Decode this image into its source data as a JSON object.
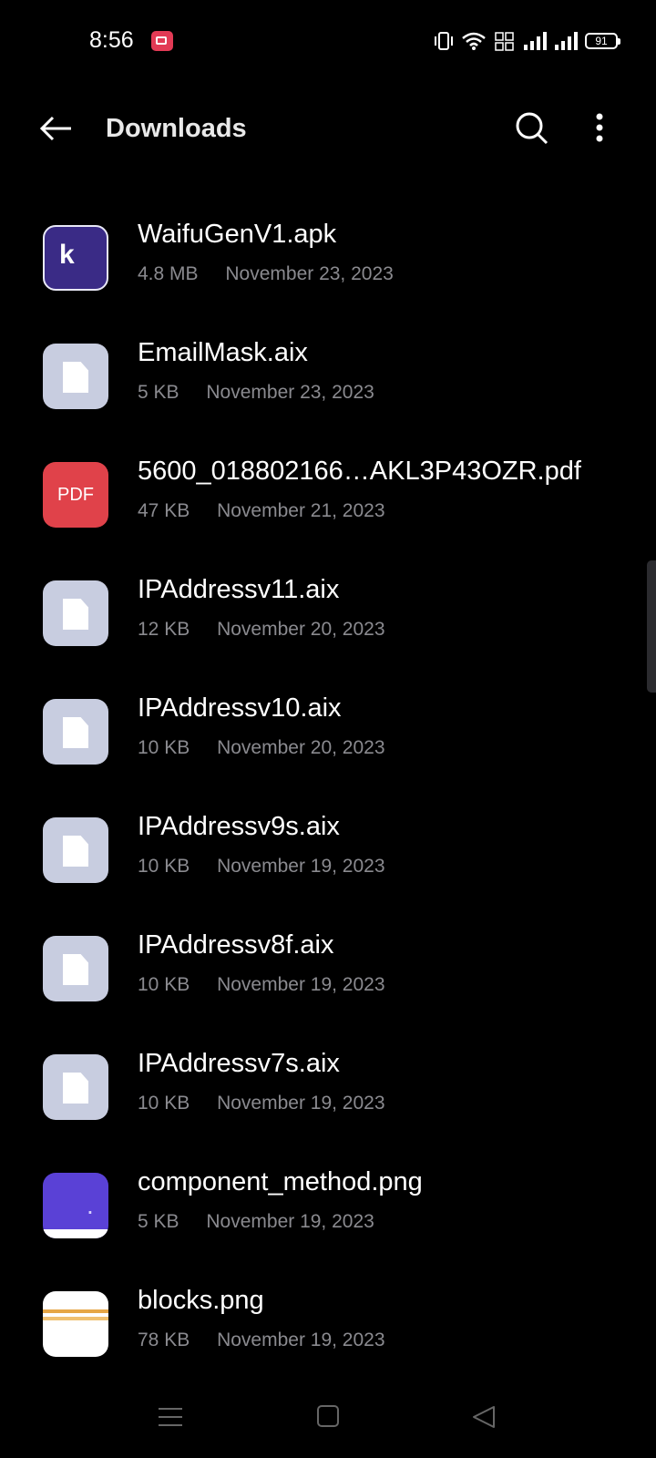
{
  "status_bar": {
    "time": "8:56",
    "battery": "91"
  },
  "header": {
    "title": "Downloads"
  },
  "files": [
    {
      "name": "WaifuGenV1.apk",
      "size": "4.8 MB",
      "date": "November 23, 2023",
      "icon": "apk-k-icon"
    },
    {
      "name": "EmailMask.aix",
      "size": "5 KB",
      "date": "November 23, 2023",
      "icon": "file-icon"
    },
    {
      "name": "5600_018802166…AKL3P43OZR.pdf",
      "size": "47 KB",
      "date": "November 21, 2023",
      "icon": "pdf-icon",
      "icon_label": "PDF"
    },
    {
      "name": "IPAddressv11.aix",
      "size": "12 KB",
      "date": "November 20, 2023",
      "icon": "file-icon"
    },
    {
      "name": "IPAddressv10.aix",
      "size": "10 KB",
      "date": "November 20, 2023",
      "icon": "file-icon"
    },
    {
      "name": "IPAddressv9s.aix",
      "size": "10 KB",
      "date": "November 19, 2023",
      "icon": "file-icon"
    },
    {
      "name": "IPAddressv8f.aix",
      "size": "10 KB",
      "date": "November 19, 2023",
      "icon": "file-icon"
    },
    {
      "name": "IPAddressv7s.aix",
      "size": "10 KB",
      "date": "November 19, 2023",
      "icon": "file-icon"
    },
    {
      "name": "component_method.png",
      "size": "5 KB",
      "date": "November 19, 2023",
      "icon": "image-thumbnail"
    },
    {
      "name": "blocks.png",
      "size": "78 KB",
      "date": "November 19, 2023",
      "icon": "image-thumbnail"
    }
  ],
  "colors": {
    "background": "#000000",
    "pdf_red": "#e0424a",
    "generic_file": "#c8cde0",
    "recording": "#e23a55"
  }
}
